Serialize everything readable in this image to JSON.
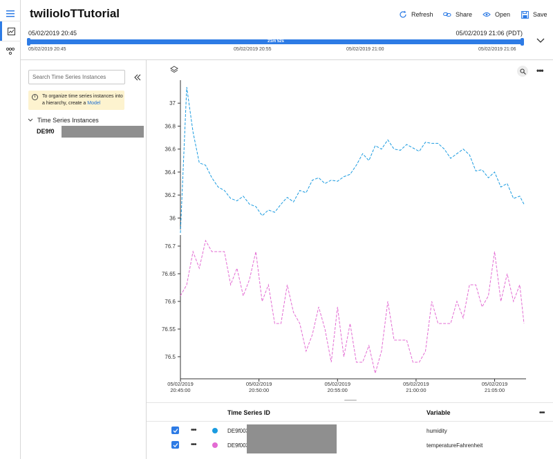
{
  "app": {
    "title": "twilioIoTTutorial"
  },
  "rail": {
    "items": [
      {
        "name": "menu-icon"
      },
      {
        "name": "chart-view-icon"
      },
      {
        "name": "model-view-icon"
      }
    ]
  },
  "toolbar": {
    "refresh_label": "Refresh",
    "share_label": "Share",
    "open_label": "Open",
    "save_label": "Save"
  },
  "time_range": {
    "start": "05/02/2019 20:45",
    "end": "05/02/2019 21:06 (PDT)",
    "duration": "21m 52s",
    "ticks": [
      "05/02/2019 20:45",
      "05/02/2019 20:55",
      "05/02/2019 21:00",
      "05/02/2019 21:06"
    ]
  },
  "sidebar": {
    "search_placeholder": "Search Time Series Instances",
    "info_text": "To organize time series instances into a hierarchy, create a ",
    "info_link": "Model",
    "tree_header": "Time Series Instances",
    "instance_label": "DE9f0"
  },
  "chart_data": [
    {
      "type": "line",
      "series_name": "humidity",
      "color": "#1a9be0",
      "ylim": [
        35.9,
        37.2
      ],
      "yticks": [
        36,
        36.2,
        36.4,
        36.6,
        36.8,
        37
      ],
      "x_minutes": [
        0,
        0.4,
        0.8,
        1.2,
        1.6,
        2.0,
        2.4,
        2.8,
        3.2,
        3.6,
        4.0,
        4.4,
        4.8,
        5.2,
        5.6,
        6.0,
        6.4,
        6.8,
        7.2,
        7.6,
        8.0,
        8.4,
        8.8,
        9.2,
        9.6,
        10.0,
        10.4,
        10.8,
        11.2,
        11.6,
        12.0,
        12.4,
        12.8,
        13.2,
        13.6,
        14.0,
        14.4,
        14.8,
        15.2,
        15.6,
        16.0,
        16.4,
        16.8,
        17.2,
        17.6,
        18.0,
        18.4,
        18.8,
        19.2,
        19.6,
        20.0,
        20.4,
        20.8,
        21.2,
        21.6,
        21.87
      ],
      "values": [
        35.87,
        37.14,
        36.75,
        36.48,
        36.46,
        36.35,
        36.27,
        36.24,
        36.17,
        36.15,
        36.19,
        36.12,
        36.1,
        36.02,
        36.07,
        36.05,
        36.12,
        36.18,
        36.14,
        36.24,
        36.22,
        36.33,
        36.35,
        36.3,
        36.33,
        36.32,
        36.36,
        36.38,
        36.46,
        36.56,
        36.5,
        36.63,
        36.6,
        36.68,
        36.6,
        36.59,
        36.64,
        36.61,
        36.58,
        36.66,
        36.65,
        36.65,
        36.6,
        36.52,
        36.56,
        36.6,
        36.55,
        36.41,
        36.42,
        36.35,
        36.4,
        36.27,
        36.3,
        36.17,
        36.19,
        36.12
      ],
      "x_ticks": [
        {
          "date": "05/02/2019",
          "time": "20:45:00"
        },
        {
          "date": "05/02/2019",
          "time": "20:50:00"
        },
        {
          "date": "05/02/2019",
          "time": "20:55:00"
        },
        {
          "date": "05/02/2019",
          "time": "21:00:00"
        },
        {
          "date": "05/02/2019",
          "time": "21:05:00"
        }
      ]
    },
    {
      "type": "line",
      "series_name": "temperatureFahrenheit",
      "color": "#e36bd3",
      "ylim": [
        76.46,
        76.72
      ],
      "yticks": [
        76.5,
        76.55,
        76.6,
        76.65,
        76.7
      ],
      "x_minutes": [
        0,
        0.4,
        0.8,
        1.2,
        1.6,
        2.0,
        2.4,
        2.8,
        3.2,
        3.6,
        4.0,
        4.4,
        4.8,
        5.2,
        5.6,
        6.0,
        6.4,
        6.8,
        7.2,
        7.6,
        8.0,
        8.4,
        8.8,
        9.2,
        9.6,
        10.0,
        10.4,
        10.8,
        11.2,
        11.6,
        12.0,
        12.4,
        12.8,
        13.2,
        13.6,
        14.0,
        14.4,
        14.8,
        15.2,
        15.6,
        16.0,
        16.4,
        16.8,
        17.2,
        17.6,
        18.0,
        18.4,
        18.8,
        19.2,
        19.6,
        20.0,
        20.4,
        20.8,
        21.2,
        21.6,
        21.87
      ],
      "values": [
        76.61,
        76.63,
        76.69,
        76.66,
        76.71,
        76.69,
        76.69,
        76.69,
        76.63,
        76.66,
        76.61,
        76.64,
        76.69,
        76.6,
        76.63,
        76.56,
        76.56,
        76.63,
        76.58,
        76.56,
        76.51,
        76.54,
        76.59,
        76.55,
        76.49,
        76.59,
        76.5,
        76.56,
        76.49,
        76.49,
        76.52,
        76.47,
        76.51,
        76.6,
        76.53,
        76.53,
        76.53,
        76.49,
        76.49,
        76.51,
        76.6,
        76.56,
        76.56,
        76.56,
        76.6,
        76.57,
        76.63,
        76.63,
        76.59,
        76.61,
        76.69,
        76.6,
        76.65,
        76.6,
        76.63,
        76.56
      ]
    }
  ],
  "legend_table": {
    "headers": {
      "id": "Time Series ID",
      "variable": "Variable"
    },
    "rows": [
      {
        "id": "DE9f003",
        "variable": "humidity",
        "color": "#1a9be0"
      },
      {
        "id": "DE9f003",
        "variable": "temperatureFahrenheit",
        "color": "#e36bd3"
      }
    ]
  }
}
